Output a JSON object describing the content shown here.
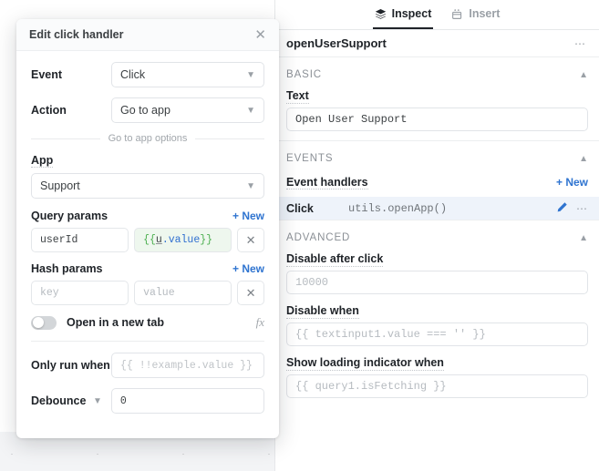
{
  "modal": {
    "title": "Edit click handler",
    "close_icon": "close-icon",
    "event": {
      "label": "Event",
      "value": "Click"
    },
    "action": {
      "label": "Action",
      "value": "Go to app"
    },
    "options_separator": "Go to app options",
    "app": {
      "label": "App",
      "value": "Support"
    },
    "query_params": {
      "label": "Query params",
      "new_label": "+ New",
      "rows": [
        {
          "key": "userId",
          "value_open": "{{ ",
          "value_ident": "u",
          "value_prop": ".value",
          "value_close": " }}",
          "remove_icon": "close-icon"
        }
      ]
    },
    "hash_params": {
      "label": "Hash params",
      "new_label": "+ New",
      "rows": [
        {
          "key_placeholder": "key",
          "value_placeholder": "value",
          "remove_icon": "close-icon"
        }
      ]
    },
    "new_tab": {
      "label": "Open in a new tab",
      "enabled": false,
      "fx_label": "fx"
    },
    "only_run_when": {
      "label": "Only run when",
      "placeholder": "{{ !!example.value }}"
    },
    "debounce": {
      "label": "Debounce",
      "value": "0"
    }
  },
  "inspector": {
    "tabs": [
      {
        "label": "Inspect",
        "icon": "layers-icon",
        "active": true
      },
      {
        "label": "Insert",
        "icon": "insert-component-icon",
        "active": false
      }
    ],
    "object_name": "openUserSupport",
    "object_menu_icon": "more-horizontal-icon",
    "sections": [
      {
        "title": "BASIC",
        "collapse_icon": "chevron-up-icon",
        "fields": [
          {
            "label": "Text",
            "value": "Open User Support",
            "placeholder": ""
          }
        ]
      },
      {
        "title": "EVENTS",
        "collapse_icon": "chevron-up-icon",
        "handlers_label": "Event handlers",
        "new_label": "+ New",
        "handlers": [
          {
            "event": "Click",
            "code": "utils.openApp()",
            "edit_icon": "pencil-icon",
            "menu_icon": "more-horizontal-icon"
          }
        ]
      },
      {
        "title": "ADVANCED",
        "collapse_icon": "chevron-up-icon",
        "fields": [
          {
            "label": "Disable after click",
            "placeholder": "10000"
          },
          {
            "label": "Disable when",
            "placeholder": "{{ textinput1.value === '' }}"
          },
          {
            "label": "Show loading indicator when",
            "placeholder": "{{ query1.isFetching }}"
          }
        ]
      }
    ]
  },
  "colors": {
    "accent_blue": "#2f74d0",
    "highlight_row": "#eef3fa",
    "binding_green": "#4caf50",
    "binding_bg": "#eef7ee"
  }
}
